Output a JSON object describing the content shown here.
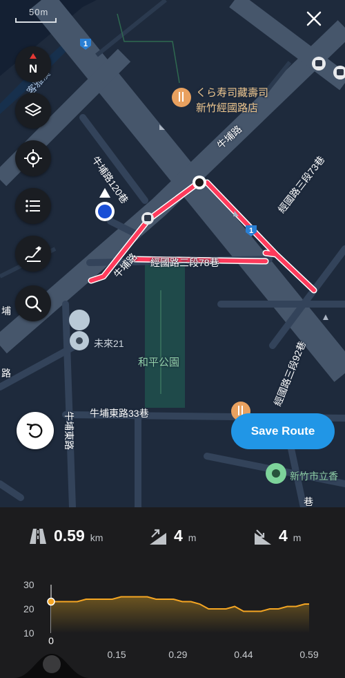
{
  "map": {
    "scale_label": "50m",
    "route_badge": "1",
    "labels": {
      "poi_sushi": "くら寿司藏壽司\n新竹經國路店",
      "road_niupu": "牛埔路",
      "road_niupu_120": "牛埔路120巷",
      "road_jingguo_73": "經國路三段73巷",
      "road_jingguo_78": "經國路三段78巷",
      "road_jingguo_92": "經國路三段92巷",
      "road_niupu_east_33": "牛埔東路33巷",
      "road_niupu_east": "牛埔東路",
      "poi_weilai": "未來21",
      "park_heping": "和平公園",
      "poi_school": "新竹市立香",
      "river": "客雅溪",
      "road_fragment_left": "埔",
      "road_fragment_left2": "路",
      "road_fragment_right": "巷"
    },
    "buttons": {
      "compass_label": "N"
    }
  },
  "actions": {
    "save_route": "Save Route"
  },
  "stats": {
    "distance": {
      "value": "0.59",
      "unit": "km"
    },
    "ascent": {
      "value": "4",
      "unit": "m"
    },
    "descent": {
      "value": "4",
      "unit": "m"
    }
  },
  "chart_data": {
    "type": "area",
    "x": [
      0,
      0.02,
      0.04,
      0.06,
      0.08,
      0.1,
      0.12,
      0.14,
      0.16,
      0.18,
      0.2,
      0.22,
      0.24,
      0.26,
      0.28,
      0.3,
      0.32,
      0.34,
      0.36,
      0.38,
      0.4,
      0.42,
      0.44,
      0.46,
      0.48,
      0.5,
      0.52,
      0.54,
      0.56,
      0.58,
      0.59
    ],
    "y": [
      23,
      23,
      23,
      23,
      24,
      24,
      24,
      24,
      25,
      25,
      25,
      25,
      24,
      24,
      24,
      23,
      23,
      22,
      20,
      20,
      20,
      21,
      19,
      19,
      19,
      20,
      20,
      21,
      21,
      22,
      22
    ],
    "yticks": [
      "30",
      "20",
      "10"
    ],
    "xticks": [
      "0",
      "0.15",
      "0.29",
      "0.44",
      "0.59"
    ],
    "xlim": [
      0,
      0.59
    ],
    "ylim": [
      10,
      30
    ],
    "line_color": "#f5a623"
  },
  "colors": {
    "route": "#ff3b5c",
    "accent": "#2196e6",
    "map_bg": "#1e2a3c"
  }
}
